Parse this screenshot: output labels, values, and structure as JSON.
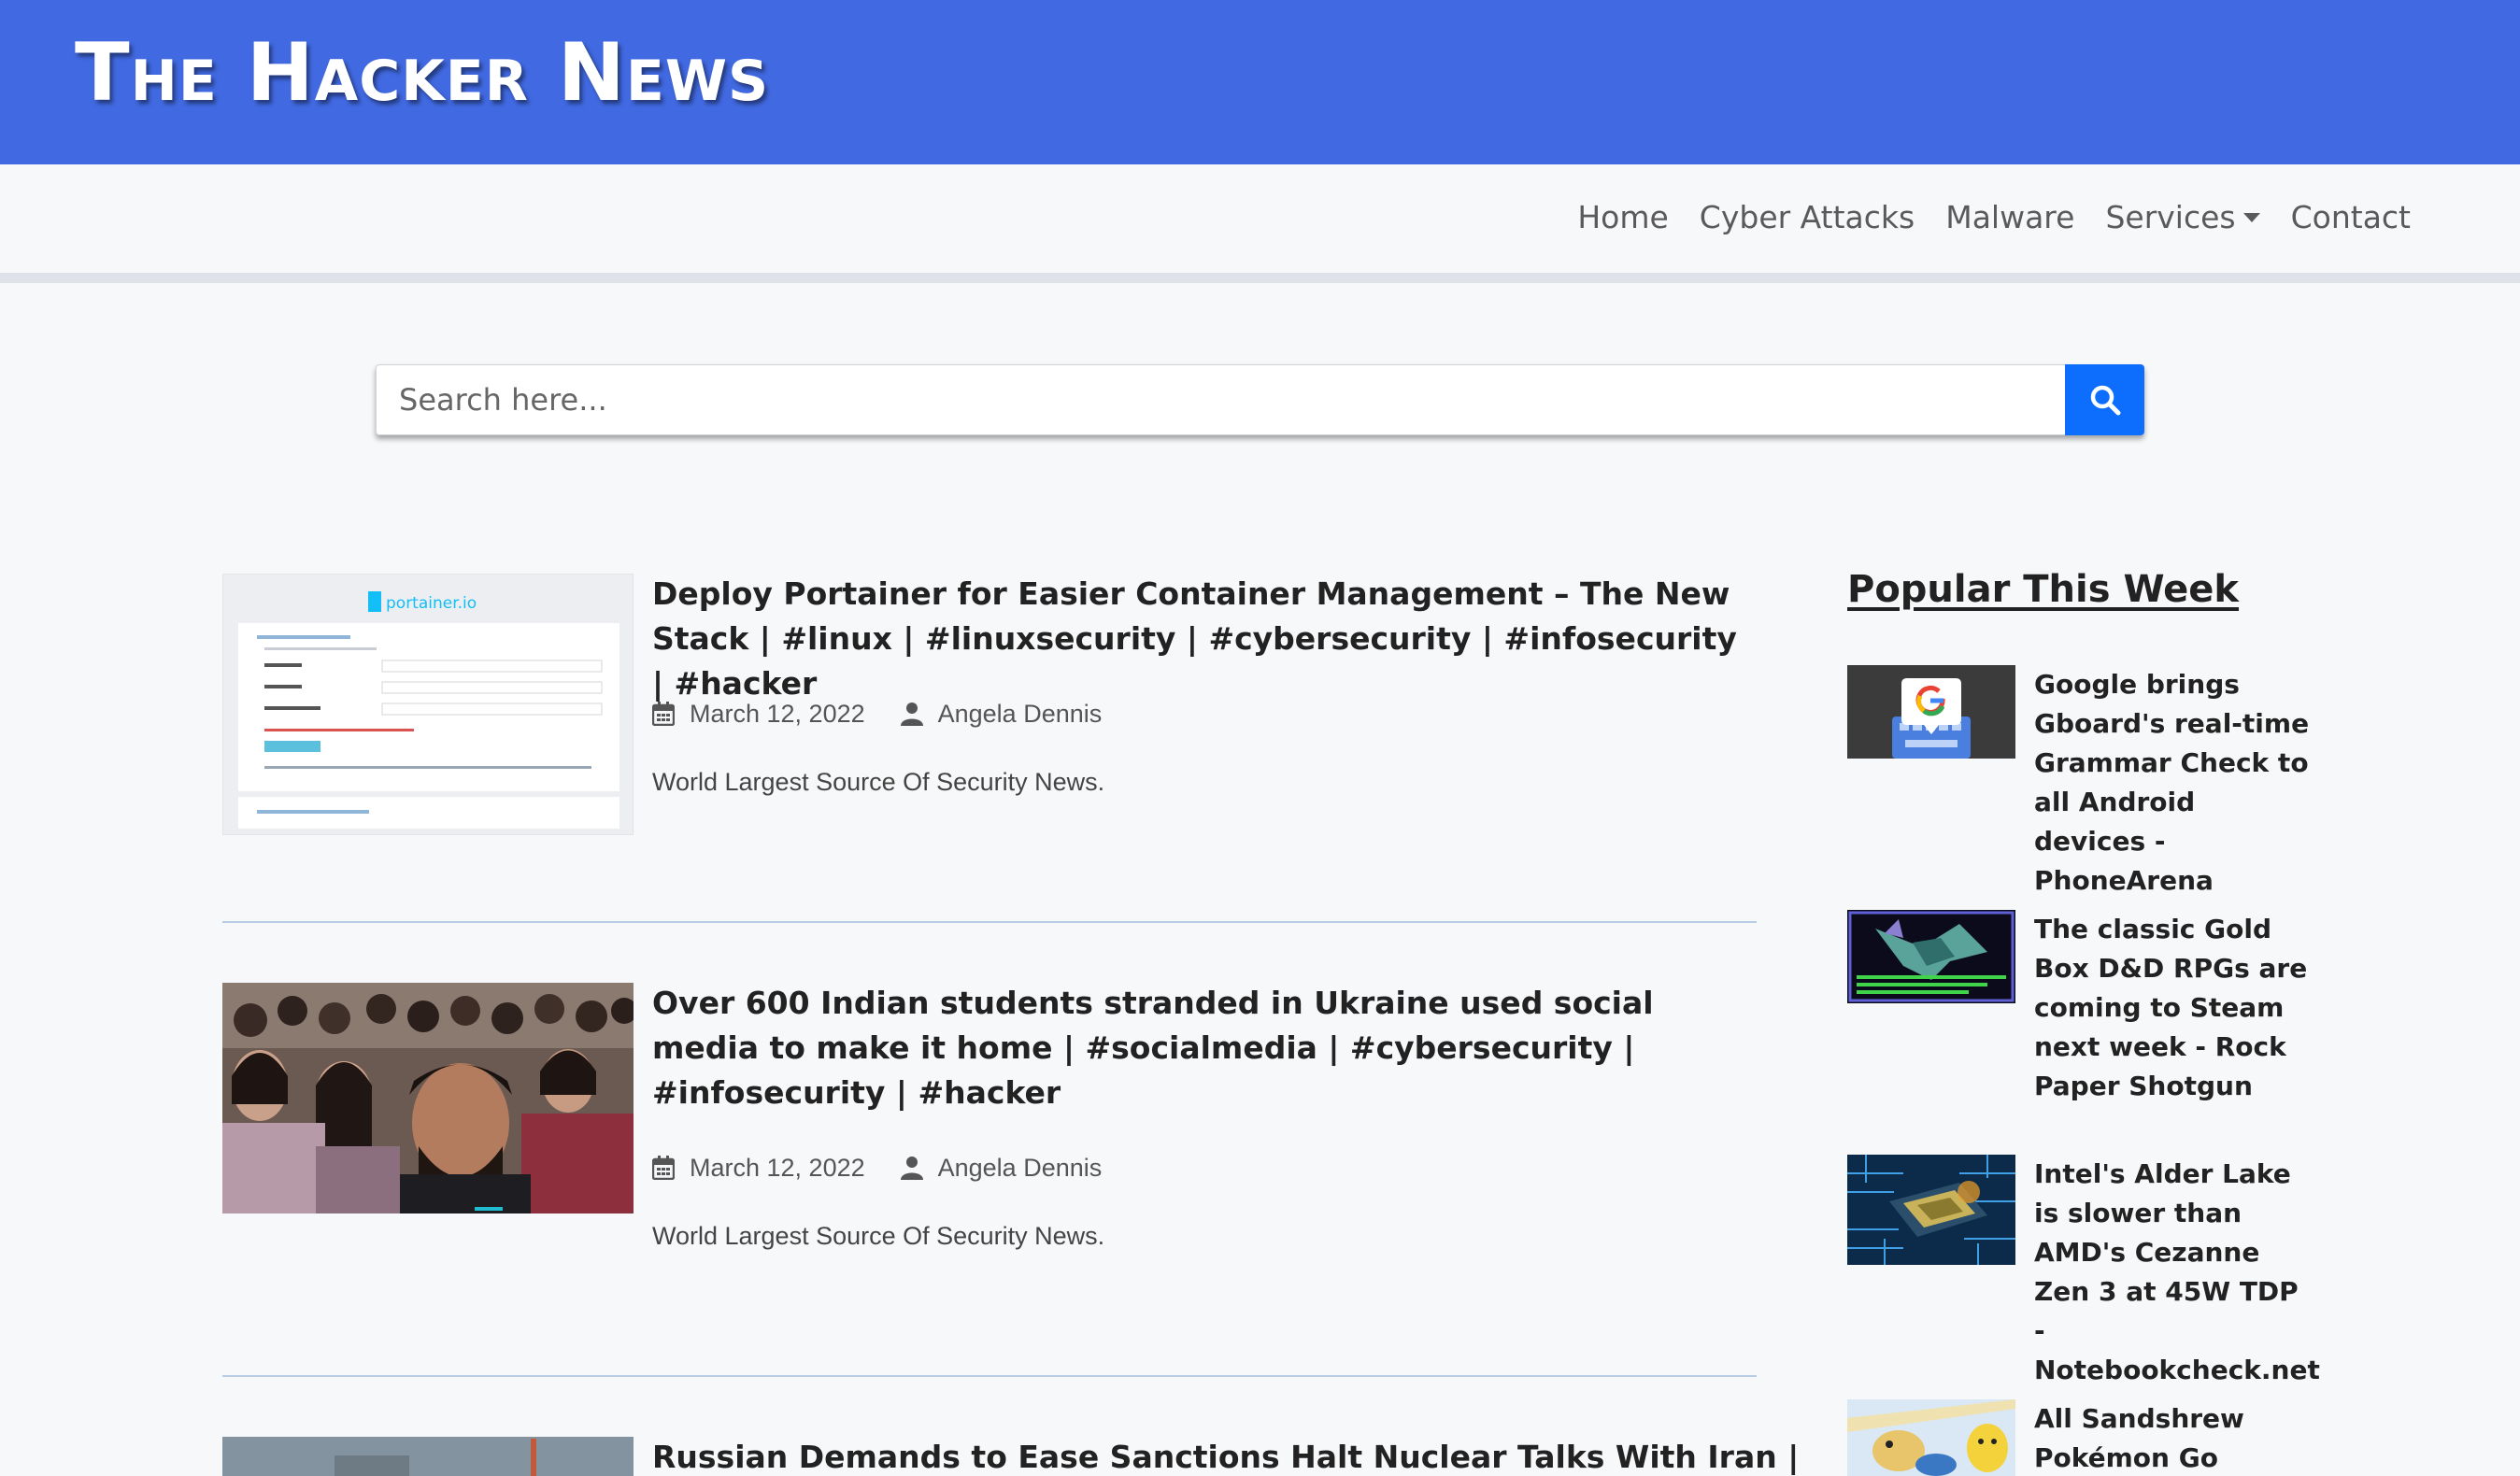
{
  "site": {
    "logo": "The Hacker News"
  },
  "nav": {
    "home": "Home",
    "cyber_attacks": "Cyber Attacks",
    "malware": "Malware",
    "services": "Services",
    "contact": "Contact"
  },
  "search": {
    "placeholder": "Search here..."
  },
  "articles": [
    {
      "title": "Deploy Portainer for Easier Container Management – The New Stack | #linux | #linuxsecurity | #cybersecurity | #infosecurity | #hacker",
      "date": "March 12, 2022",
      "author": "Angela Dennis",
      "excerpt": "World Largest Source Of Security News.",
      "thumb_brand": "portainer.io"
    },
    {
      "title": "Over 600 Indian students stranded in Ukraine used social media to make it home | #socialmedia | #cybersecurity | #infosecurity | #hacker",
      "date": "March 12, 2022",
      "author": "Angela Dennis",
      "excerpt": "World Largest Source Of Security News."
    },
    {
      "title": "Russian Demands to Ease Sanctions Halt Nuclear Talks With Iran |"
    }
  ],
  "sidebar": {
    "title": "Popular This Week",
    "items": [
      {
        "title": "Google brings Gboard's real-time Grammar Check to all Android devices - PhoneArena"
      },
      {
        "title": "The classic Gold Box D&D RPGs are coming to Steam next week - Rock Paper Shotgun"
      },
      {
        "title": "Intel's Alder Lake is slower than AMD's Cezanne Zen 3 at 45W TDP - Notebookcheck.net"
      },
      {
        "title": "All Sandshrew Pokémon Go"
      }
    ]
  },
  "colors": {
    "header_bg": "#4169e1",
    "search_button": "#0d6efd",
    "page_bg": "#f7f8fa"
  }
}
